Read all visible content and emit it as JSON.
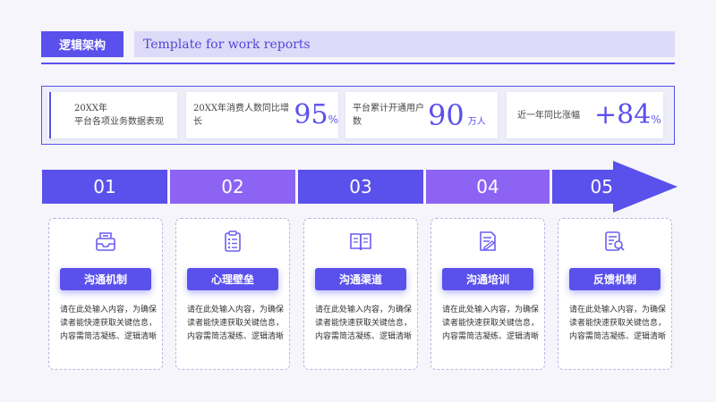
{
  "header": {
    "tag": "逻辑架构",
    "subtitle": "Template for work reports"
  },
  "stats": {
    "intro_line1": "20XX年",
    "intro_line2": "平台各项业务数据表现",
    "s1_label": "20XX年消费人数同比增长",
    "s1_value": "95",
    "s1_unit": "%",
    "s2_label_line1": "平台累计开通用户",
    "s2_label_line2": "数",
    "s2_value": "90",
    "s2_unit": "万人",
    "s3_label": "近一年同比涨幅",
    "s3_value": "+84",
    "s3_unit": "%"
  },
  "steps": [
    "01",
    "02",
    "03",
    "04",
    "05"
  ],
  "cards": [
    {
      "title": "沟通机制",
      "icon": "inbox-tray-icon",
      "text": [
        "请在此处输入内容，为确保",
        "读者能快速获取关键信息，",
        "内容需简洁凝练、逻辑清晰"
      ]
    },
    {
      "title": "心理壁垒",
      "icon": "clipboard-checklist-icon",
      "text": [
        "请在此处输入内容，为确保",
        "读者能快速获取关键信息，",
        "内容需简洁凝练、逻辑清晰"
      ]
    },
    {
      "title": "沟通渠道",
      "icon": "open-book-icon",
      "text": [
        "请在此处输入内容，为确保",
        "读者能快速获取关键信息，",
        "内容需简洁凝练、逻辑清晰"
      ]
    },
    {
      "title": "沟通培训",
      "icon": "document-edit-icon",
      "text": [
        "请在此处输入内容，为确保",
        "读者能快速获取关键信息，",
        "内容需简洁凝练、逻辑清晰"
      ]
    },
    {
      "title": "反馈机制",
      "icon": "document-search-icon",
      "text": [
        "请在此处输入内容，为确保",
        "读者能快速获取关键信息，",
        "内容需简洁凝练、逻辑清晰"
      ]
    }
  ],
  "colors": {
    "primary": "#5a50ec",
    "secondary": "#8d63f3",
    "subtitle_bar": "#dddbf7",
    "background": "#f5f5fb"
  }
}
